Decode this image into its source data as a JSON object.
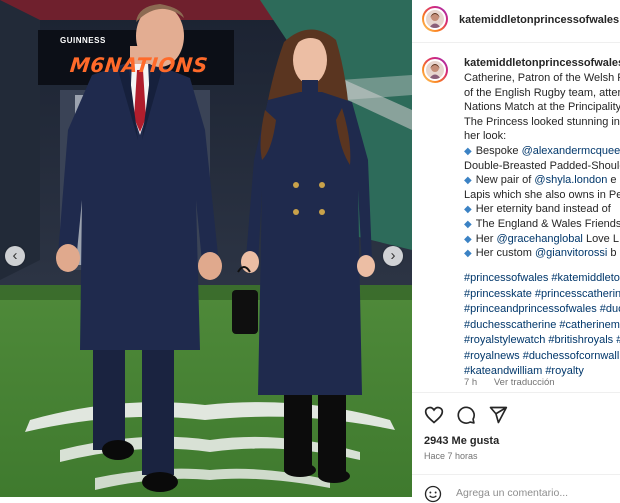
{
  "account": {
    "username": "katemiddletonprincessofwales"
  },
  "photo": {
    "sign_brand": "GUINNESS",
    "sign_text": "M6NATIONS",
    "carousel_prev_icon": "chevron-left-icon",
    "carousel_next_icon": "chevron-right-icon"
  },
  "caption": {
    "lines": [
      "Catherine, Patron of the Welsh R",
      "of the English Rugby team, atter",
      "Nations Match at the Principality",
      "The Princess looked stunning in",
      "her look:"
    ],
    "bullets": [
      {
        "prefix": "Bespoke ",
        "link": "@alexandermcquee",
        "suffix": ""
      },
      {
        "prefix": "Double-Breasted Padded-Shoulc",
        "link": "",
        "suffix": "",
        "continuation": true
      },
      {
        "prefix": "New pair of ",
        "link": "@shyla.london",
        "suffix": " e"
      },
      {
        "prefix": "Lapis which she also owns in Pea",
        "link": "",
        "suffix": "",
        "continuation": true
      },
      {
        "prefix": "Her eternity band instead of",
        "link": "",
        "suffix": ""
      },
      {
        "prefix": "The England & Wales Friends",
        "link": "",
        "suffix": ""
      },
      {
        "prefix": "Her ",
        "link": "@gracehanglobal",
        "suffix": " Love L"
      },
      {
        "prefix": "Her custom ",
        "link": "@gianvitorossi",
        "suffix": " b"
      }
    ],
    "hashtags": [
      "#princessofwales #katemiddleto",
      "#princesskate #princesscatherin",
      "#princeandprincessofwales #duc",
      "#duchesscatherine #catherinem",
      "#royalstylewatch #britishroyals #",
      "#royalnews #duchessofcornwall",
      "#kateandwilliam #royalty"
    ],
    "age": "7 h",
    "translate": "Ver traducción"
  },
  "actions": {
    "like_icon": "heart-icon",
    "comment_icon": "comment-icon",
    "share_icon": "share-icon"
  },
  "stats": {
    "likes": "2943 Me gusta",
    "time": "Hace 7 horas"
  },
  "comment": {
    "placeholder": "Agrega un comentario...",
    "emoji_icon": "emoji-icon"
  },
  "colors": {
    "link": "#00376b",
    "bullet": "#3b82c4",
    "sign_text": "#ff6a2a",
    "coat": "#1f2a4d"
  }
}
